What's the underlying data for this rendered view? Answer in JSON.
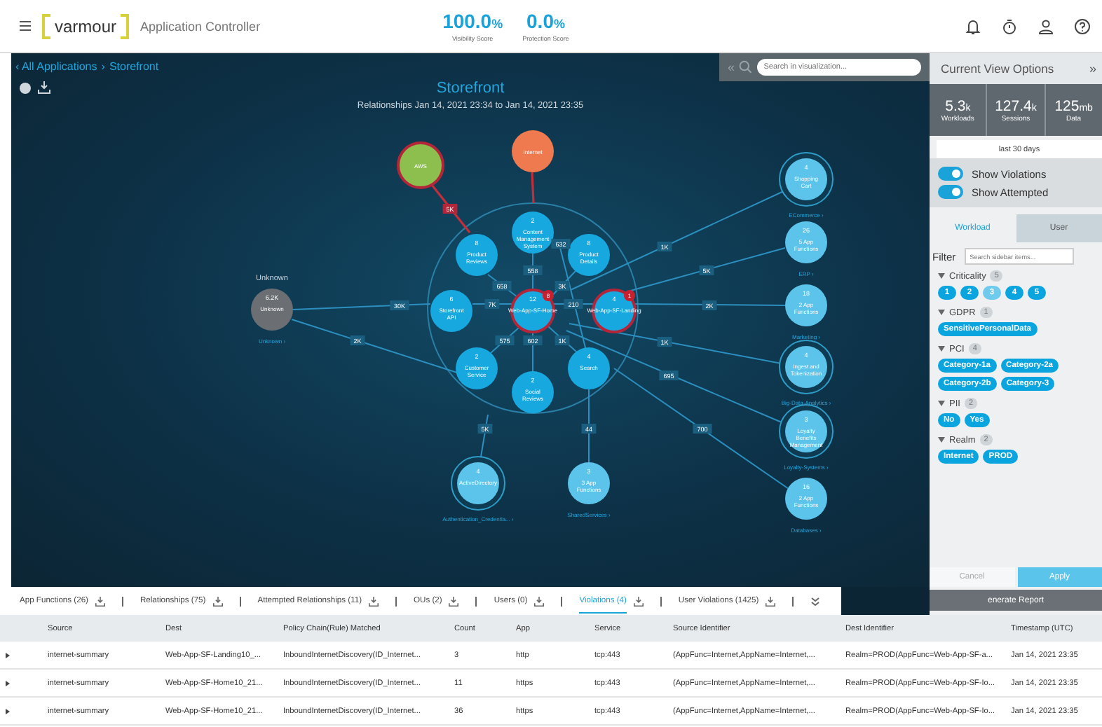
{
  "header": {
    "brand": "varmour",
    "product": "Application Controller",
    "scores": [
      {
        "value": "100.0",
        "unit": "%",
        "label": "Visibility Score"
      },
      {
        "value": "0.0",
        "unit": "%",
        "label": "Protection Score"
      }
    ]
  },
  "breadcrumb": {
    "parent": "‹ All Applications",
    "separator": "›",
    "current": "Storefront"
  },
  "search": {
    "collapse": "«",
    "placeholder": "Search in visualization..."
  },
  "graph": {
    "title": "Storefront",
    "subtitle": "Relationships Jan 14, 2021 23:34 to Jan 14, 2021 23:35",
    "nodes": [
      {
        "kind": "cloud",
        "label": "AWS",
        "violation": true
      },
      {
        "kind": "internet",
        "label": "Internet",
        "violation": false
      },
      {
        "kind": "app",
        "label": "Content Management System",
        "count": "2",
        "violation": false
      },
      {
        "kind": "app",
        "label": "Product Reviews",
        "count": "8",
        "violation": false
      },
      {
        "kind": "app",
        "label": "Product Details",
        "count": "8",
        "violation": false
      },
      {
        "kind": "app",
        "label": "Storefront API",
        "count": "6",
        "violation": false
      },
      {
        "kind": "app",
        "label": "Web-App-SF-Home",
        "count": "12",
        "badge": "8",
        "violation": true
      },
      {
        "kind": "app",
        "label": "Web-App-SF-Landing",
        "count": "4",
        "badge": "1",
        "violation": true
      },
      {
        "kind": "app",
        "label": "Customer Service",
        "count": "2",
        "violation": false
      },
      {
        "kind": "app",
        "label": "Social Reviews",
        "count": "2",
        "violation": false
      },
      {
        "kind": "app",
        "label": "Search",
        "count": "4",
        "violation": false
      },
      {
        "kind": "group",
        "label": "ActiveDirectory",
        "count": "4",
        "ring": true,
        "group_label": "Authentication_Credentia... ›",
        "violation": false
      },
      {
        "kind": "group",
        "label": "3 App Functions",
        "count": "3",
        "ring": false,
        "group_label": "SharedServices ›",
        "violation": false
      },
      {
        "kind": "unknown",
        "label": "Unknown",
        "count": "6.2K",
        "title": "Unknown",
        "group_label": "Unknown ›",
        "violation": false
      },
      {
        "kind": "group",
        "label": "Shopping Cart",
        "count": "4",
        "ring": true,
        "group_label": "ECommerce ›",
        "violation": false
      },
      {
        "kind": "group",
        "label": "5 App Functions",
        "count": "26",
        "ring": false,
        "group_label": "ERP ›",
        "violation": false
      },
      {
        "kind": "group",
        "label": "2 App Functions",
        "count": "18",
        "ring": false,
        "group_label": "Marketing ›",
        "violation": false
      },
      {
        "kind": "group",
        "label": "Ingest and Tokenization",
        "count": "4",
        "ring": true,
        "group_label": "Big-Data-Analytics ›",
        "violation": false
      },
      {
        "kind": "group",
        "label": "Loyalty Benefits Management",
        "count": "3",
        "ring": true,
        "group_label": "Loyalty-Systems ›",
        "violation": false
      },
      {
        "kind": "group",
        "label": "2 App Functions",
        "count": "16",
        "ring": false,
        "group_label": "Databases ›",
        "violation": false
      }
    ],
    "edges": [
      {
        "violation": true
      },
      {
        "label": "5K",
        "violation": true
      },
      {
        "label": "632",
        "violation": false
      },
      {
        "label": "1K",
        "violation": false
      },
      {
        "label": "558",
        "violation": false
      },
      {
        "label": "5K",
        "violation": false
      },
      {
        "label": "658",
        "violation": false
      },
      {
        "label": "3K",
        "violation": false
      },
      {
        "label": "30K",
        "violation": false
      },
      {
        "label": "7K",
        "violation": false
      },
      {
        "label": "210",
        "violation": false
      },
      {
        "label": "2K",
        "violation": false
      },
      {
        "label": "2K",
        "violation": false
      },
      {
        "label": "575",
        "violation": false
      },
      {
        "label": "602",
        "violation": false
      },
      {
        "label": "1K",
        "violation": false
      },
      {
        "label": "1K",
        "violation": false
      },
      {
        "label": "695",
        "violation": false
      },
      {
        "label": "5K",
        "violation": false
      },
      {
        "label": "44",
        "violation": false
      },
      {
        "label": "700",
        "violation": false
      }
    ]
  },
  "panel": {
    "title": "Current View Options",
    "collapse": "»",
    "stats": [
      {
        "value": "5.3",
        "unit": "k",
        "label": "Workloads"
      },
      {
        "value": "127.4",
        "unit": "k",
        "label": "Sessions"
      },
      {
        "value": "125",
        "unit": "mb",
        "label": "Data"
      }
    ],
    "range": "last 30 days",
    "toggles": [
      {
        "label": "Show Violations",
        "on": true
      },
      {
        "label": "Show Attempted",
        "on": true
      }
    ],
    "tabs": [
      {
        "label": "Workload",
        "selected": true
      },
      {
        "label": "User",
        "selected": false
      }
    ],
    "filter": {
      "label": "Filter",
      "placeholder": "Search sidebar items..."
    },
    "groups": [
      {
        "name": "Criticality",
        "count": "5",
        "chips": [
          {
            "label": "1",
            "dimmed": false
          },
          {
            "label": "2",
            "dimmed": false
          },
          {
            "label": "3",
            "dimmed": true
          },
          {
            "label": "4",
            "dimmed": false
          },
          {
            "label": "5",
            "dimmed": false
          }
        ]
      },
      {
        "name": "GDPR",
        "count": "1",
        "chips": [
          {
            "label": "SensitivePersonalData",
            "dimmed": false
          }
        ]
      },
      {
        "name": "PCI",
        "count": "4",
        "chips": [
          {
            "label": "Category-1a",
            "dimmed": false
          },
          {
            "label": "Category-2a",
            "dimmed": false
          },
          {
            "label": "Category-2b",
            "dimmed": false
          },
          {
            "label": "Category-3",
            "dimmed": false
          }
        ]
      },
      {
        "name": "PII",
        "count": "2",
        "chips": [
          {
            "label": "No",
            "dimmed": false
          },
          {
            "label": "Yes",
            "dimmed": false
          }
        ]
      },
      {
        "name": "Realm",
        "count": "2",
        "chips": [
          {
            "label": "Internet",
            "dimmed": false
          },
          {
            "label": "PROD",
            "dimmed": false
          }
        ]
      }
    ],
    "buttons": [
      {
        "kind": "cancel",
        "label": "Cancel"
      },
      {
        "kind": "apply",
        "label": "Apply"
      }
    ],
    "report": "enerate Report"
  },
  "tabs": [
    {
      "label": "App Functions (26)",
      "selected": false
    },
    {
      "label": "Relationships (75)",
      "selected": false
    },
    {
      "label": "Attempted Relationships (11)",
      "selected": false
    },
    {
      "label": "OUs (2)",
      "selected": false
    },
    {
      "label": "Users (0)",
      "selected": false
    },
    {
      "label": "Violations (4)",
      "selected": true
    },
    {
      "label": "User Violations (1425)",
      "selected": false
    }
  ],
  "table": {
    "columns": [
      "Source",
      "Dest",
      "Policy Chain(Rule) Matched",
      "Count",
      "App",
      "Service",
      "Source Identifier",
      "Dest Identifier",
      "Timestamp (UTC)"
    ],
    "rows": [
      [
        "internet-summary",
        "Web-App-SF-Landing10_...",
        "InboundInternetDiscovery(ID_Internet...",
        "3",
        "http",
        "tcp:443",
        "(AppFunc=Internet,AppName=Internet,...",
        "Realm=PROD(AppFunc=Web-App-SF-a...",
        "Jan 14, 2021 23:35"
      ],
      [
        "internet-summary",
        "Web-App-SF-Home10_21...",
        "InboundInternetDiscovery(ID_Internet...",
        "11",
        "https",
        "tcp:443",
        "(AppFunc=Internet,AppName=Internet,...",
        "Realm=PROD(AppFunc=Web-App-SF-Io...",
        "Jan 14, 2021 23:35"
      ],
      [
        "internet-summary",
        "Web-App-SF-Home10_21...",
        "InboundInternetDiscovery(ID_Internet...",
        "36",
        "https",
        "tcp:443",
        "(AppFunc=Internet,AppName=Internet,...",
        "Realm=PROD(AppFunc=Web-App-SF-Io...",
        "Jan 14, 2021 23:35"
      ]
    ]
  }
}
